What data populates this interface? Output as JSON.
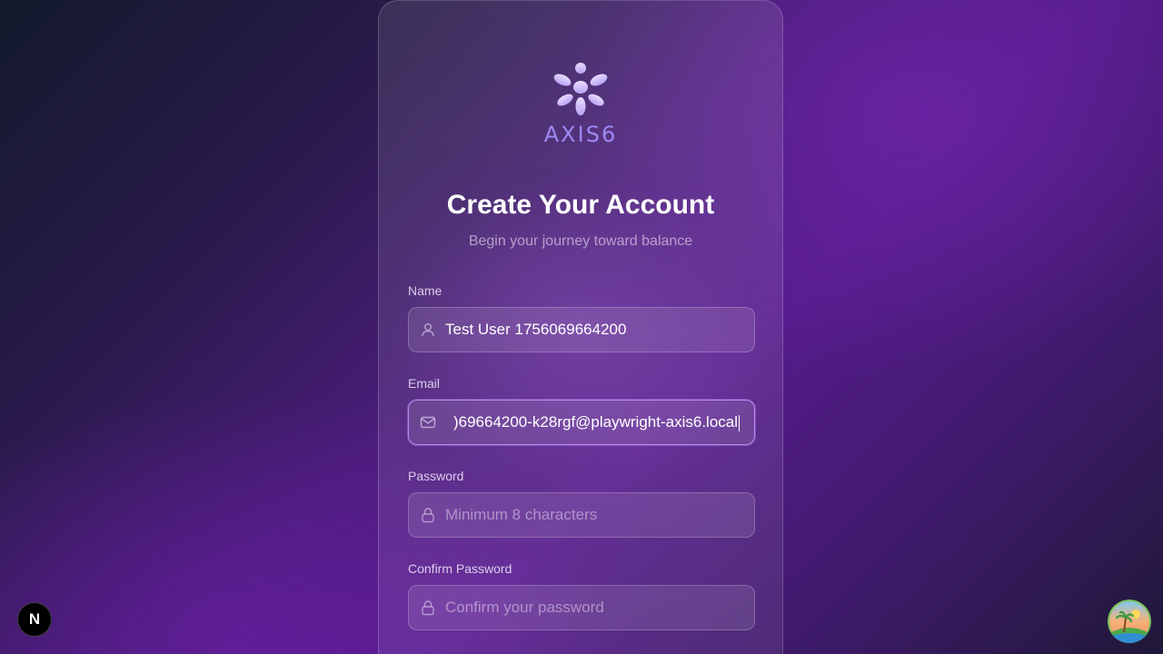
{
  "brand": {
    "logo_icon": "axis6-flower-logo-icon",
    "name": "AXIS6",
    "color": "#9b8af3"
  },
  "header": {
    "title": "Create Your Account",
    "subtitle": "Begin your journey toward balance"
  },
  "form": {
    "name": {
      "label": "Name",
      "icon": "user-icon",
      "value": "Test User 1756069664200",
      "placeholder": ""
    },
    "email": {
      "label": "Email",
      "icon": "mail-icon",
      "value": ")69664200-k28rgf@playwright-axis6.local",
      "focused": true
    },
    "password": {
      "label": "Password",
      "icon": "lock-icon",
      "value": "",
      "placeholder": "Minimum 8 characters"
    },
    "confirm_password": {
      "label": "Confirm Password",
      "icon": "lock-icon",
      "value": "",
      "placeholder": "Confirm your password"
    }
  },
  "overlays": {
    "dev_badge_label": "N",
    "dev_badge_icon": "nextjs-icon",
    "avatar_icon": "palm-island-avatar-icon"
  },
  "colors": {
    "focus_border": "#c896ff",
    "background_accent": "#561c8c"
  }
}
